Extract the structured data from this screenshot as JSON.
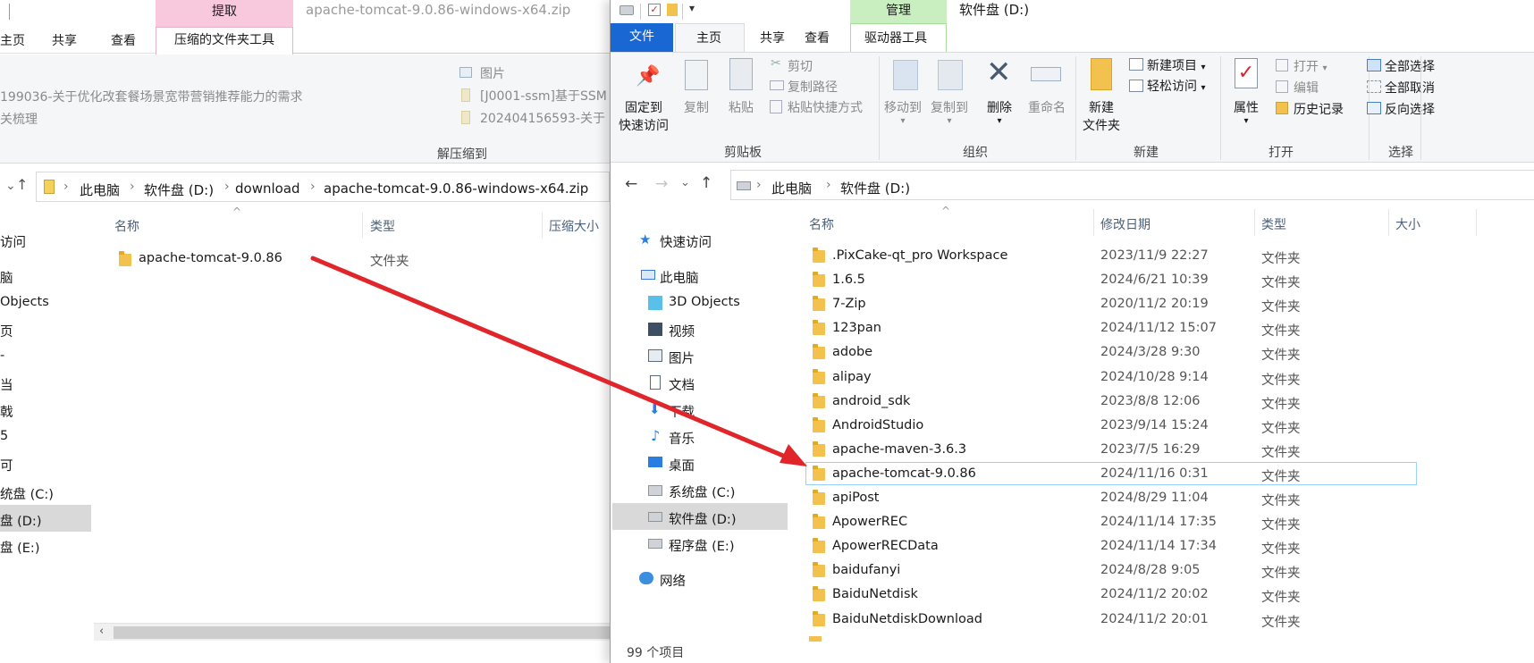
{
  "left_window": {
    "context_tab": "提取",
    "title": "apache-tomcat-9.0.86-windows-x64.zip",
    "tabs": [
      "主页",
      "共享",
      "查看"
    ],
    "active_tab": "压缩的文件夹工具",
    "ribbon": {
      "recent_items": [
        "199036-关于优化改套餐场景宽带营销推荐能力的需求",
        "关梳理"
      ],
      "recent_items_right": [
        "图片",
        "[J0001-ssm]基于SSM",
        "202404156593-关于"
      ],
      "group_label": "解压缩到"
    },
    "address": [
      "此电脑",
      "软件盘 (D:)",
      "download",
      "apache-tomcat-9.0.86-windows-x64.zip"
    ],
    "columns": [
      "名称",
      "类型",
      "压缩大小"
    ],
    "files": [
      {
        "name": "apache-tomcat-9.0.86",
        "type": "文件夹"
      }
    ],
    "nav": [
      "访问",
      "脑",
      "Objects",
      "页",
      "-",
      "当",
      "戟",
      "5",
      "可",
      "统盘 (C:)",
      "盘 (D:)",
      "盘 (E:)"
    ]
  },
  "right_window": {
    "context_tab": "管理",
    "title": "软件盘 (D:)",
    "tabs": {
      "file": "文件",
      "home": "主页",
      "share": "共享",
      "view": "查看",
      "drive_tools": "驱动器工具"
    },
    "ribbon": {
      "pin": "固定到",
      "pin2": "快速访问",
      "copy": "复制",
      "paste": "粘贴",
      "cut": "剪切",
      "copy_path": "复制路径",
      "paste_shortcut": "粘贴快捷方式",
      "clipboard_group": "剪贴板",
      "move_to": "移动到",
      "copy_to": "复制到",
      "delete": "删除",
      "rename": "重命名",
      "organize_group": "组织",
      "new_folder": "新建",
      "new_folder2": "文件夹",
      "new_item": "新建项目",
      "easy_access": "轻松访问",
      "new_group": "新建",
      "properties": "属性",
      "open": "打开",
      "edit": "编辑",
      "history": "历史记录",
      "open_group": "打开",
      "select_all": "全部选择",
      "select_none": "全部取消",
      "invert": "反向选择",
      "select_group": "选择"
    },
    "address": [
      "此电脑",
      "软件盘 (D:)"
    ],
    "columns": [
      "名称",
      "修改日期",
      "类型",
      "大小"
    ],
    "nav": {
      "quick_access": "快速访问",
      "this_pc": "此电脑",
      "objects3d": "3D Objects",
      "videos": "视频",
      "pictures": "图片",
      "documents": "文档",
      "downloads": "下载",
      "music": "音乐",
      "desktop": "桌面",
      "drive_c": "系统盘 (C:)",
      "drive_d": "软件盘 (D:)",
      "drive_e": "程序盘 (E:)",
      "network": "网络"
    },
    "files": [
      {
        "name": ".PixCake-qt_pro Workspace",
        "date": "2023/11/9 22:27",
        "type": "文件夹"
      },
      {
        "name": "1.6.5",
        "date": "2024/6/21 10:39",
        "type": "文件夹"
      },
      {
        "name": "7-Zip",
        "date": "2020/11/2 20:19",
        "type": "文件夹"
      },
      {
        "name": "123pan",
        "date": "2024/11/12 15:07",
        "type": "文件夹"
      },
      {
        "name": "adobe",
        "date": "2024/3/28 9:30",
        "type": "文件夹"
      },
      {
        "name": "alipay",
        "date": "2024/10/28 9:14",
        "type": "文件夹"
      },
      {
        "name": "android_sdk",
        "date": "2023/8/8 12:06",
        "type": "文件夹"
      },
      {
        "name": "AndroidStudio",
        "date": "2023/9/14 15:24",
        "type": "文件夹"
      },
      {
        "name": "apache-maven-3.6.3",
        "date": "2023/7/5 16:29",
        "type": "文件夹"
      },
      {
        "name": "apache-tomcat-9.0.86",
        "date": "2024/11/16 0:31",
        "type": "文件夹"
      },
      {
        "name": "apiPost",
        "date": "2024/8/29 11:04",
        "type": "文件夹"
      },
      {
        "name": "ApowerREC",
        "date": "2024/11/14 17:35",
        "type": "文件夹"
      },
      {
        "name": "ApowerRECData",
        "date": "2024/11/14 17:34",
        "type": "文件夹"
      },
      {
        "name": "baidufanyi",
        "date": "2024/8/28 9:05",
        "type": "文件夹"
      },
      {
        "name": "BaiduNetdisk",
        "date": "2024/11/2 20:02",
        "type": "文件夹"
      },
      {
        "name": "BaiduNetdiskDownload",
        "date": "2024/11/2 20:01",
        "type": "文件夹"
      }
    ],
    "status": "99 个项目"
  },
  "annotation": {
    "arrow_color": "#e0252b"
  }
}
